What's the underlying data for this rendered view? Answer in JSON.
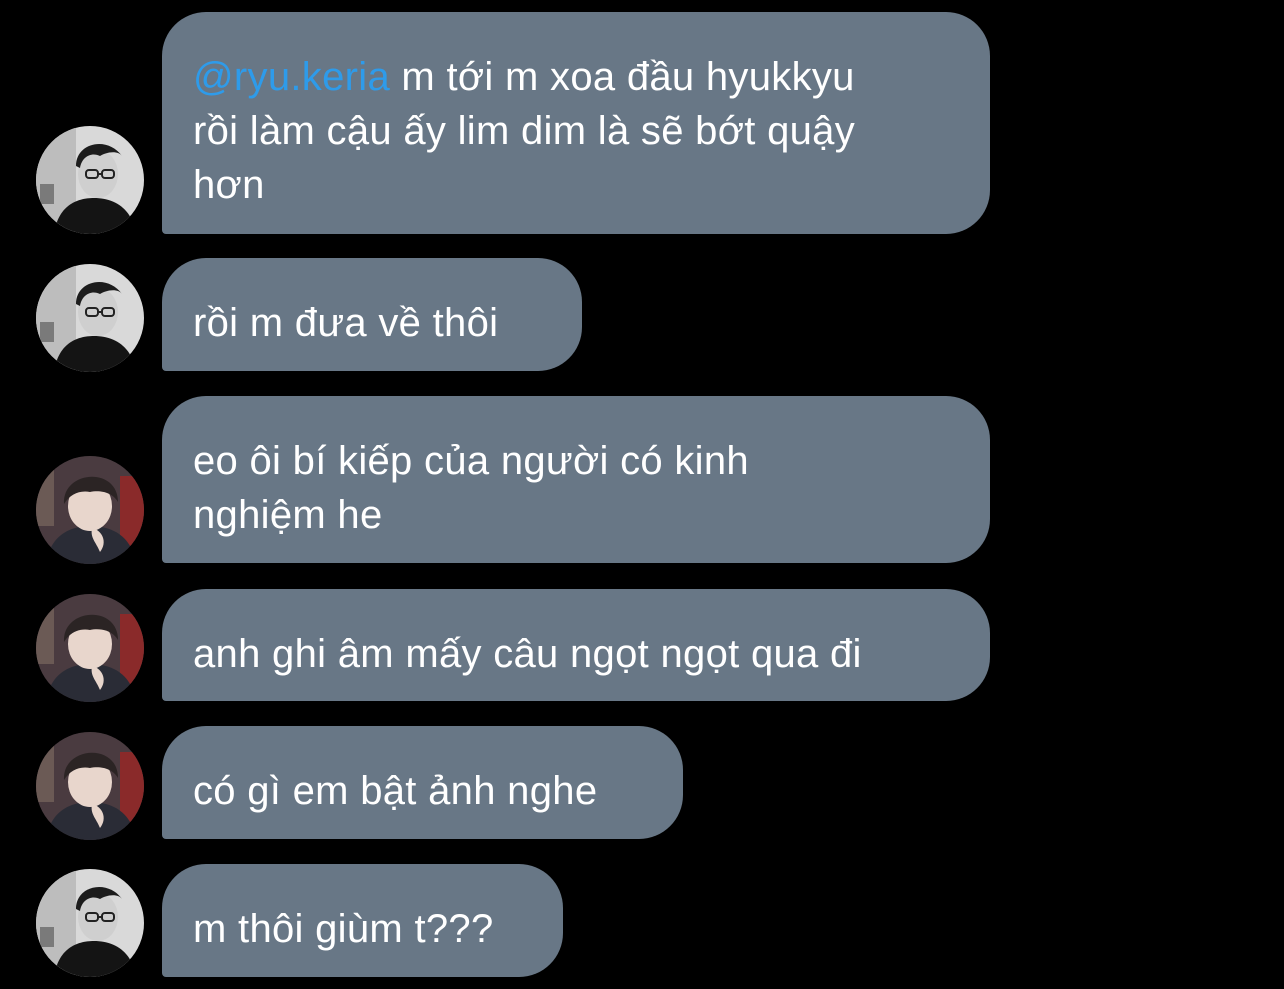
{
  "colors": {
    "background": "#000000",
    "bubble": "#687786",
    "text": "#ffffff",
    "mention": "#2e9bea"
  },
  "messages": [
    {
      "sender_avatar": "avatar-dark-haired-glasses",
      "mention": "@ryu.keria",
      "lines": [
        "m tới m xoa đầu hyukkyu",
        "rồi làm cậu ấy lim dim là sẽ bớt quậy",
        "hơn"
      ]
    },
    {
      "sender_avatar": "avatar-dark-haired-glasses",
      "lines": [
        "rồi m đưa về thôi"
      ]
    },
    {
      "sender_avatar": "avatar-bowl-cut",
      "lines": [
        "eo ôi bí kiếp của người có kinh",
        "nghiệm he"
      ]
    },
    {
      "sender_avatar": "avatar-bowl-cut",
      "lines": [
        "anh ghi âm mấy câu ngọt ngọt qua đi"
      ]
    },
    {
      "sender_avatar": "avatar-bowl-cut",
      "lines": [
        "có gì em bật ảnh nghe"
      ]
    },
    {
      "sender_avatar": "avatar-dark-haired-glasses",
      "lines": [
        "m thôi giùm t???"
      ]
    }
  ]
}
